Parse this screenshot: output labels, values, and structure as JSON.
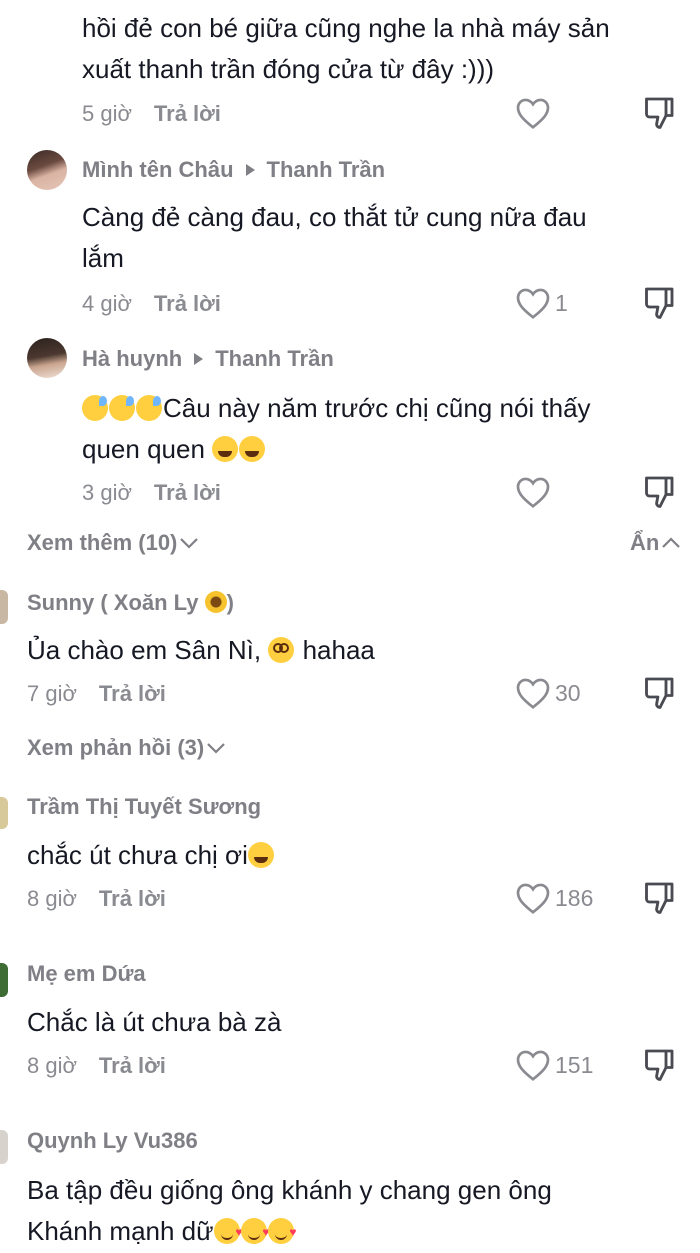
{
  "comments": [
    {
      "text": "hồi đẻ con bé giữa cũng nghe la nhà máy sản xuất thanh trần đóng cửa từ đây :)))",
      "time": "5 giờ",
      "reply": "Trả lời",
      "likes": ""
    },
    {
      "author": "Mình tên Châu",
      "reply_to": "Thanh Trần",
      "text": "Càng đẻ càng đau, co thắt tử cung nữa đau lắm",
      "time": "4 giờ",
      "reply": "Trả lời",
      "likes": "1"
    },
    {
      "author": "Hà huynh",
      "reply_to": "Thanh Trần",
      "text": "Câu này năm trước chị cũng nói thấy quen quen",
      "time": "3 giờ",
      "reply": "Trả lời",
      "likes": ""
    },
    {
      "author": "Sunny ( Xoăn Ly",
      "author_suffix": ")",
      "text": "Ủa chào em Sân Nì,",
      "text_after": "hahaa",
      "time": "7 giờ",
      "reply": "Trả lời",
      "likes": "30"
    },
    {
      "author": "Trầm Thị Tuyết Sương",
      "text": "chắc út chưa chị ơi",
      "time": "8 giờ",
      "reply": "Trả lời",
      "likes": "186"
    },
    {
      "author": "Mẹ em Dứa",
      "text": "Chắc là út chưa bà zà",
      "time": "8 giờ",
      "reply": "Trả lời",
      "likes": "151"
    },
    {
      "author": "Quynh Ly Vu386",
      "text": "Ba tập đều giống ông khánh y chang gen ông Khánh mạnh dữ"
    }
  ],
  "view_more": "Xem thêm (10)",
  "hide": "Ẩn",
  "view_replies": "Xem phản hồi (3)",
  "colors": {
    "text": "#161823",
    "secondary": "#8a8b91",
    "name": "#7f7f86"
  }
}
